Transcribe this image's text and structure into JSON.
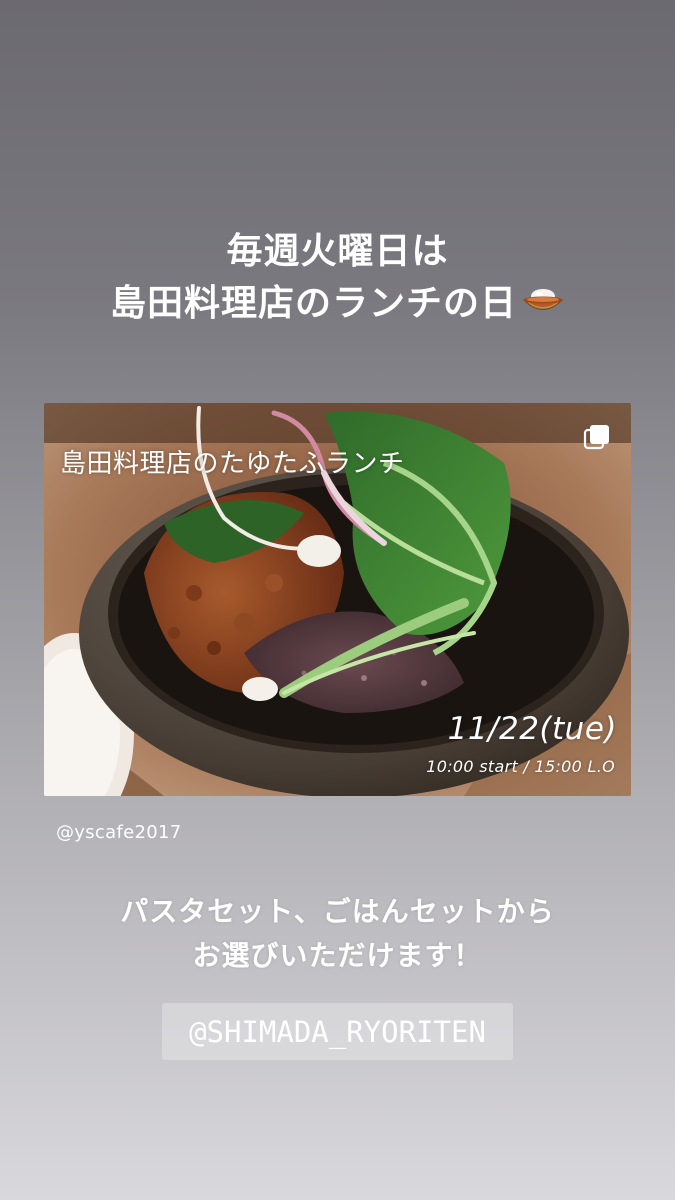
{
  "headline": {
    "line1": "毎週火曜日は",
    "line2": "島田料理店のランチの日"
  },
  "shared_post": {
    "image_title": "島田料理店のたゆたふランチ",
    "date": "11/22(tue)",
    "time": "10:00 start / 15:00 L.O",
    "author_handle": "@yscafe2017",
    "icon": "multiple-photos-icon"
  },
  "caption": {
    "line1": "パスタセット、ごはんセットから",
    "line2": "お選びいただけます！"
  },
  "mention_sticker": {
    "label": "@SHIMADA_RYORITEN"
  },
  "colors": {
    "background_top": "#6b6a70",
    "background_bottom": "#d9d8dc",
    "text": "#ffffff"
  }
}
